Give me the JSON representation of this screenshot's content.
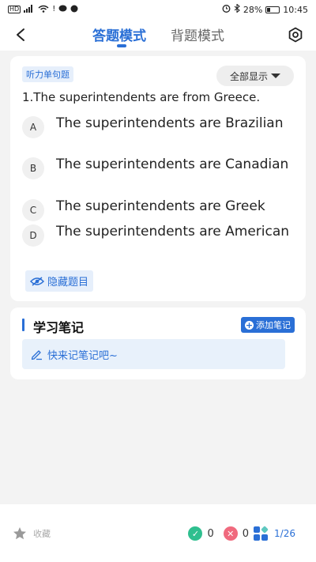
{
  "status_bar": {
    "network": "HD",
    "signal_label": "4G",
    "battery": "28%",
    "time": "10:45"
  },
  "nav": {
    "tab_answer": "答题模式",
    "tab_memorize": "背题模式"
  },
  "question": {
    "type_label": "听力单句题",
    "show_all": "全部显示",
    "text": "1.The superintendents are from Greece.",
    "options": [
      {
        "letter": "A",
        "text": "The superintendents are Brazilian"
      },
      {
        "letter": "B",
        "text": "The superintendents are Canadian"
      },
      {
        "letter": "C",
        "text": "The superintendents are Greek"
      },
      {
        "letter": "D",
        "text": "The superintendents are American"
      }
    ],
    "hide_label": "隐藏题目"
  },
  "notes": {
    "title": "学习笔记",
    "add_label": "添加笔记",
    "placeholder": "快来记笔记吧~"
  },
  "bottom": {
    "favorite_label": "收藏",
    "correct_count": "0",
    "wrong_count": "0",
    "progress": "1/26"
  },
  "colors": {
    "accent": "#2a6fd6",
    "correct": "#2fbf8f",
    "wrong": "#f06a7e"
  }
}
